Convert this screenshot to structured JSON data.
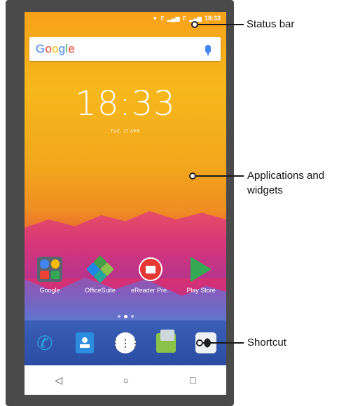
{
  "status_bar": {
    "signal_text_1": "E",
    "signal_text_2": "E",
    "time": "18:33"
  },
  "search": {
    "logo": "Google",
    "mic_icon": "microphone-icon"
  },
  "clock": {
    "time": "18:33",
    "date": "TUE, 17 APR"
  },
  "apps": [
    {
      "label": "Google",
      "icon": "google-folder-icon"
    },
    {
      "label": "OfficeSuite",
      "icon": "officesuite-icon"
    },
    {
      "label": "eReader Pre..",
      "icon": "ereader-icon"
    },
    {
      "label": "Play Store",
      "icon": "play-store-icon"
    }
  ],
  "page_indicator": {
    "count": 3,
    "active": 1
  },
  "dock": [
    {
      "icon": "phone-icon"
    },
    {
      "icon": "contacts-icon"
    },
    {
      "icon": "all-apps-icon"
    },
    {
      "icon": "messaging-icon"
    },
    {
      "icon": "clock-app-icon"
    }
  ],
  "navbar": {
    "back": "◁",
    "home": "○",
    "recents": "□"
  },
  "callouts": {
    "status_bar": "Status bar",
    "applications_line1": "Applications and",
    "applications_line2": "widgets",
    "shortcut": "Shortcut"
  }
}
